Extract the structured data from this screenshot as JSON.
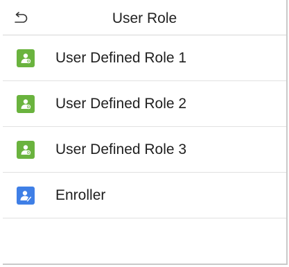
{
  "header": {
    "title": "User Role",
    "back_icon": "back-arrow-icon"
  },
  "roles": [
    {
      "label": "User Defined Role 1",
      "icon": "user-role-icon",
      "icon_color": "#6ab33e"
    },
    {
      "label": "User Defined Role 2",
      "icon": "user-role-icon",
      "icon_color": "#6ab33e"
    },
    {
      "label": "User Defined Role 3",
      "icon": "user-role-icon",
      "icon_color": "#6ab33e"
    },
    {
      "label": "Enroller",
      "icon": "enroller-icon",
      "icon_color": "#3f7fe6"
    }
  ]
}
